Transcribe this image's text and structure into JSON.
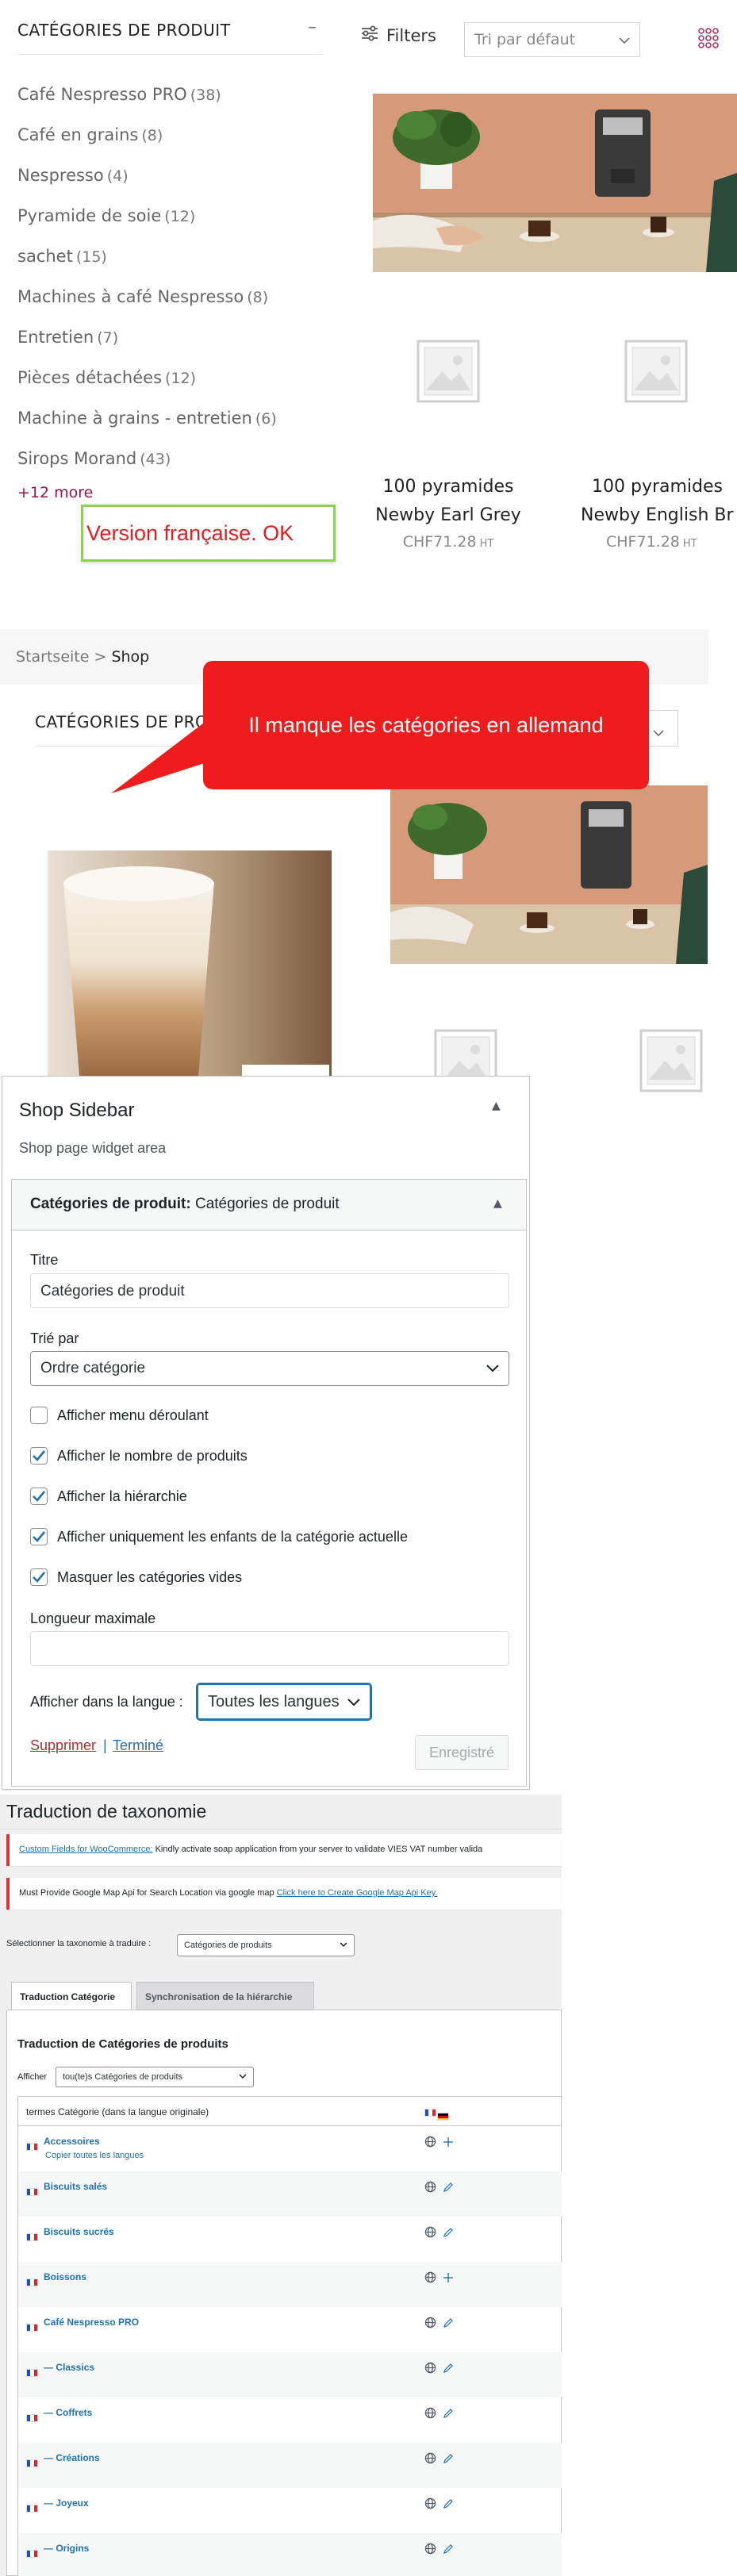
{
  "fr_shop": {
    "categories_title": "CATÉGORIES DE PRODUIT",
    "collapse_symbol": "–",
    "categories": [
      {
        "name": "Café Nespresso PRO",
        "count": "(38)"
      },
      {
        "name": "Café en grains",
        "count": "(8)"
      },
      {
        "name": "Nespresso",
        "count": "(4)"
      },
      {
        "name": "Pyramide de soie",
        "count": "(12)"
      },
      {
        "name": "sachet",
        "count": "(15)"
      },
      {
        "name": "Machines à café Nespresso",
        "count": "(8)"
      },
      {
        "name": "Entretien",
        "count": "(7)"
      },
      {
        "name": "Pièces détachées",
        "count": "(12)"
      },
      {
        "name": "Machine à grains - entretien",
        "count": "(6)"
      },
      {
        "name": "Sirops Morand",
        "count": "(43)"
      }
    ],
    "more_link": "+12 more",
    "filters_label": "Filters",
    "sort_value": "Tri par défaut",
    "products": [
      {
        "title_line1": "100 pyramides",
        "title_line2": "Newby Earl Grey",
        "price": "CHF71.28",
        "tax": "HT"
      },
      {
        "title_line1": "100 pyramides",
        "title_line2": "Newby English Br",
        "price": "CHF71.28",
        "tax": "HT"
      }
    ],
    "green_note": "Version française. OK"
  },
  "de_shop": {
    "breadcrumb_home": "Startseite",
    "breadcrumb_sep": ">",
    "breadcrumb_current": "Shop",
    "categories_title_fragment": "CATÉGORIES DE PRO",
    "red_note": "Il manque les catégories en allemand"
  },
  "widget": {
    "sidebar_title": "Shop Sidebar",
    "sidebar_desc": "Shop page widget area",
    "head_bold": "Catégories de produit:",
    "head_rest": "Catégories de produit",
    "title_label": "Titre",
    "title_value": "Catégories de produit",
    "sort_label": "Trié par",
    "sort_value": "Ordre catégorie",
    "options": [
      {
        "label": "Afficher menu déroulant",
        "checked": false
      },
      {
        "label": "Afficher le nombre de produits",
        "checked": true
      },
      {
        "label": "Afficher la hiérarchie",
        "checked": true
      },
      {
        "label": "Afficher uniquement les enfants de la catégorie actuelle",
        "checked": true
      },
      {
        "label": "Masquer les catégories vides",
        "checked": true
      }
    ],
    "max_length_label": "Longueur maximale",
    "max_length_value": "",
    "language_label": "Afficher dans la langue :",
    "language_value": "Toutes les langues",
    "delete_link": "Supprimer",
    "separator": "|",
    "done_link": "Terminé",
    "saved_button": "Enregistré"
  },
  "taxonomy": {
    "page_title": "Traduction de taxonomie",
    "notice1_link": "Custom Fields for WooCommerce:",
    "notice1_text": " Kindly activate soap application from your server to validate VIES VAT number valida",
    "notice2_text": "Must Provide Google Map Api for Search Location via google map ",
    "notice2_link": "Click here to Create Google Map Api Key.",
    "select_label": "Sélectionner la taxonomie à traduire :",
    "select_value": "Catégories de produits",
    "tab_active": "Traduction Catégorie",
    "tab_inactive": "Synchronisation de la hiérarchie",
    "panel_title": "Traduction de Catégories de produits",
    "show_label": "Afficher",
    "show_value": "tou(te)s Catégories de produits",
    "table_header": "termes Catégorie (dans la langue originale)",
    "copy_all": "Copier toutes les langues",
    "rows": [
      {
        "name": "Accessoires",
        "action": "plus"
      },
      {
        "name": "Biscuits salés",
        "action": "pencil"
      },
      {
        "name": "Biscuits sucrés",
        "action": "pencil"
      },
      {
        "name": "Boissons",
        "action": "plus"
      },
      {
        "name": "Café Nespresso PRO",
        "action": "pencil"
      },
      {
        "name": "— Classics",
        "action": "pencil"
      },
      {
        "name": "— Coffrets",
        "action": "pencil"
      },
      {
        "name": "— Créations",
        "action": "pencil"
      },
      {
        "name": "— Joyeux",
        "action": "pencil"
      },
      {
        "name": "— Origins",
        "action": "pencil"
      }
    ]
  },
  "colors": {
    "accent_link": "#9b1650",
    "wp_blue": "#2271b1",
    "callout_red": "#ee1c1c",
    "callout_green_border": "#8fd14f"
  },
  "icons": [
    "filter-sliders-icon",
    "chevron-down-icon",
    "grid-view-icon",
    "image-placeholder-icon",
    "collapse-arrow-icon",
    "checkmark-icon",
    "globe-icon",
    "pencil-icon",
    "plus-icon",
    "flag-fr-icon",
    "flag-de-icon"
  ]
}
